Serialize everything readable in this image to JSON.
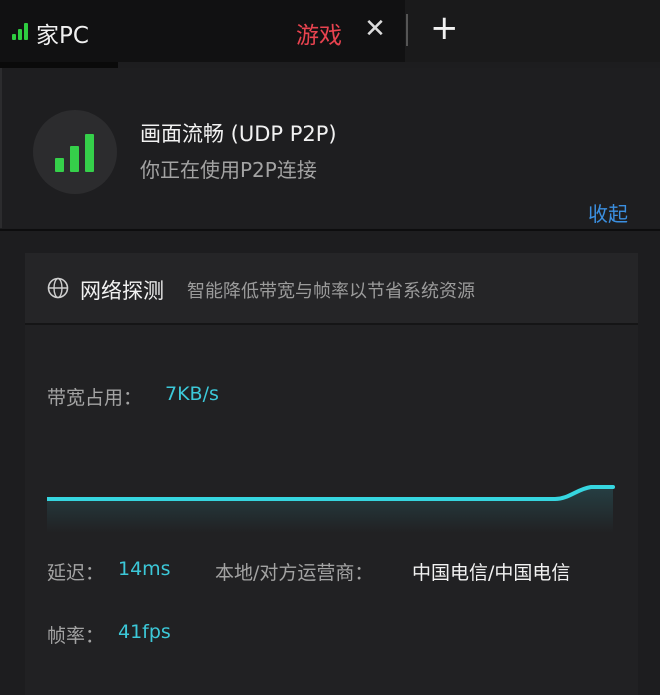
{
  "tab": {
    "title": "家PC",
    "game_label": "游戏",
    "close_glyph": "✕",
    "add_glyph": "+"
  },
  "status": {
    "title": "画面流畅 (UDP P2P)",
    "subtitle": "你正在使用P2P连接",
    "collapse_label": "收起",
    "signal_color": "#35d04a"
  },
  "probe": {
    "title": "网络探测",
    "description": "智能降低带宽与帧率以节省系统资源",
    "bandwidth_label": "带宽占用：",
    "bandwidth_value": "7KB/s",
    "latency_label": "延迟：",
    "latency_value": "14ms",
    "isp_label": "本地/对方运营商：",
    "isp_value": "中国电信/中国电信",
    "fps_label": "帧率：",
    "fps_value": "41fps",
    "accent_color": "#3cc8d8"
  }
}
